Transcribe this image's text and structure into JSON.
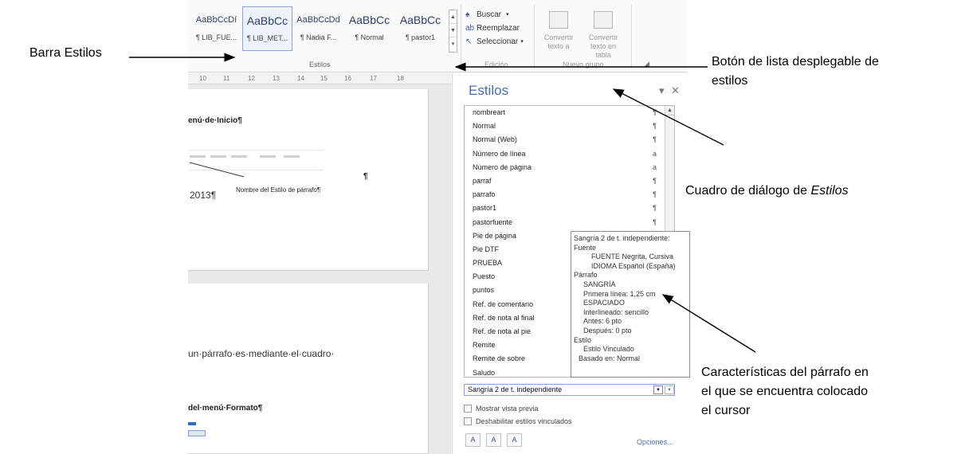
{
  "ribbon": {
    "gallery": [
      {
        "preview": "AaBbCcDí",
        "caption": "¶ LIB_FUE..."
      },
      {
        "preview": "AaBbCc",
        "caption": "¶ LIB_MET..."
      },
      {
        "preview": "AaBbCcDd",
        "caption": "¶ Nadia F..."
      },
      {
        "preview": "AaBbCc",
        "caption": "¶ Normal"
      },
      {
        "preview": "AaBbCc",
        "caption": "¶ pastor1"
      }
    ],
    "styles_group_label": "Estilos",
    "edit": {
      "find": "Buscar",
      "replace": "Reemplazar",
      "select": "Seleccionar",
      "group_label": "Edición"
    },
    "convert1": "Convertir texto a",
    "convert2": "Convertir texto en tabla",
    "new_group_label": "Nuevo grupo"
  },
  "ruler": {
    "ticks": [
      "10",
      "11",
      "12",
      "13",
      "14",
      "15",
      "16",
      "17",
      "18"
    ]
  },
  "document": {
    "heading1": "enú·de·Inicio¶",
    "caption": "Nombre del Estilo de párrafo¶",
    "pilcrow": "¶",
    "year": "2013¶",
    "body_line": "un·párrafo·es·mediante·el·cuadro·",
    "heading2": "del·menú·Formato¶"
  },
  "pane": {
    "title": "Estilos",
    "styles": [
      {
        "name": "nombreart",
        "mark": "¶"
      },
      {
        "name": "Normal",
        "mark": "¶"
      },
      {
        "name": "Normal (Web)",
        "mark": "¶"
      },
      {
        "name": "Número de línea",
        "mark": "a"
      },
      {
        "name": "Número de página",
        "mark": "a"
      },
      {
        "name": "parraf",
        "mark": "¶"
      },
      {
        "name": "parrafo",
        "mark": "¶"
      },
      {
        "name": "pastor1",
        "mark": "¶"
      },
      {
        "name": "pastorfuente",
        "mark": "¶"
      },
      {
        "name": "Pie de página",
        "mark": ""
      },
      {
        "name": "Pie DTF",
        "mark": ""
      },
      {
        "name": "PRUEBA",
        "mark": ""
      },
      {
        "name": "Puesto",
        "mark": ""
      },
      {
        "name": "puntos",
        "mark": ""
      },
      {
        "name": "Ref. de comentario",
        "mark": ""
      },
      {
        "name": "Ref. de nota al final",
        "mark": ""
      },
      {
        "name": "Ref. de nota al pie",
        "mark": ""
      },
      {
        "name": "Remite",
        "mark": ""
      },
      {
        "name": "Remite de sobre",
        "mark": ""
      },
      {
        "name": "Saludo",
        "mark": ""
      }
    ],
    "tooltip": [
      "Sangría 2 de t. independiente:",
      "Fuente",
      "FUENTE Negrita, Cursiva",
      "IDIOMA Español (España)",
      "Párrafo",
      "SANGRÍA",
      "Primera línea: 1,25 cm",
      "ESPACIADO",
      "Interlineado: sencillo",
      "Antes: 6 pto",
      "Después: 0 pto",
      "Estilo",
      "Estilo Vinculado",
      "Basado en: Normal"
    ],
    "current_style": "Sangría 2 de t. independiente",
    "show_preview": "Mostrar vista previa",
    "disable_linked": "Deshabilitar estilos vinculados",
    "options": "Opciones..."
  },
  "annotations": {
    "barra": "Barra Estilos",
    "boton": "Botón de lista desplegable de",
    "boton2": "estilos",
    "cuadro_prefix": "Cuadro de diálogo de ",
    "cuadro_em": "Estilos",
    "caract1": "Características del párrafo en",
    "caract2": "el que se encuentra colocado",
    "caract3": "el cursor"
  }
}
